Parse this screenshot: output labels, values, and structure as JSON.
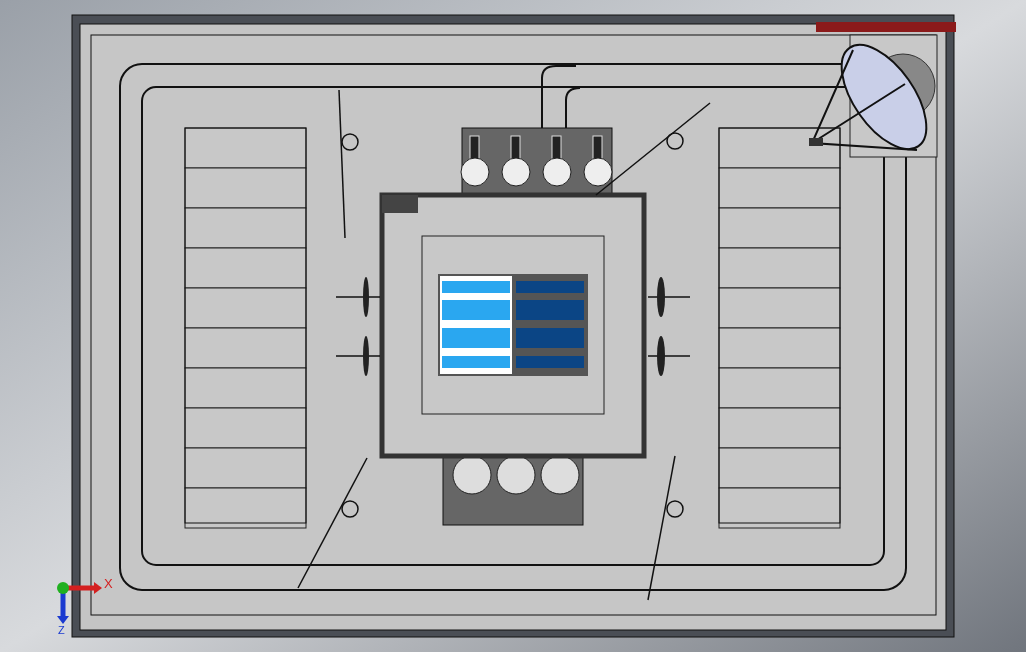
{
  "viewport": {
    "triad": {
      "x_label": "X",
      "z_label": "Z"
    }
  }
}
